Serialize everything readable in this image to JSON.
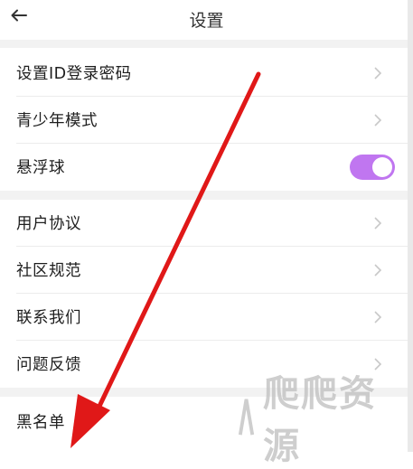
{
  "header": {
    "title": "设置",
    "back_icon": "arrow-left-icon"
  },
  "settings": {
    "password": "设置ID登录密码",
    "teen_mode": "青少年模式",
    "float_ball": "悬浮球",
    "float_ball_enabled": true,
    "user_agreement": "用户协议",
    "community_rules": "社区规范",
    "contact_us": "联系我们",
    "feedback": "问题反馈",
    "blacklist": "黑名单"
  },
  "watermark": {
    "text": "爬爬资源"
  },
  "colors": {
    "toggle_on": "#c076f0",
    "annotation_arrow": "#e01818",
    "section_gap": "#f2f2f2"
  }
}
